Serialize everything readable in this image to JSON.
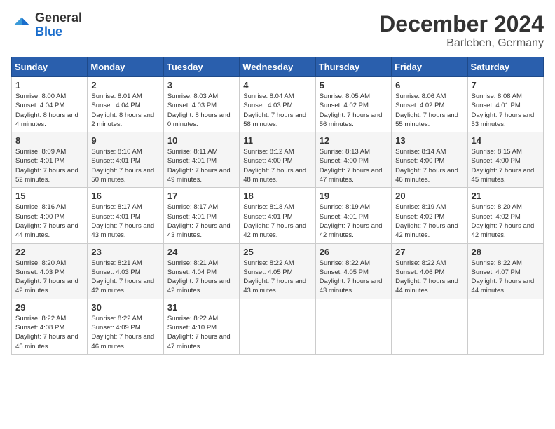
{
  "header": {
    "logo_general": "General",
    "logo_blue": "Blue",
    "month_title": "December 2024",
    "location": "Barleben, Germany"
  },
  "days_of_week": [
    "Sunday",
    "Monday",
    "Tuesday",
    "Wednesday",
    "Thursday",
    "Friday",
    "Saturday"
  ],
  "weeks": [
    [
      {
        "day": "1",
        "sunrise": "8:00 AM",
        "sunset": "4:04 PM",
        "daylight": "8 hours and 4 minutes."
      },
      {
        "day": "2",
        "sunrise": "8:01 AM",
        "sunset": "4:04 PM",
        "daylight": "8 hours and 2 minutes."
      },
      {
        "day": "3",
        "sunrise": "8:03 AM",
        "sunset": "4:03 PM",
        "daylight": "8 hours and 0 minutes."
      },
      {
        "day": "4",
        "sunrise": "8:04 AM",
        "sunset": "4:03 PM",
        "daylight": "7 hours and 58 minutes."
      },
      {
        "day": "5",
        "sunrise": "8:05 AM",
        "sunset": "4:02 PM",
        "daylight": "7 hours and 56 minutes."
      },
      {
        "day": "6",
        "sunrise": "8:06 AM",
        "sunset": "4:02 PM",
        "daylight": "7 hours and 55 minutes."
      },
      {
        "day": "7",
        "sunrise": "8:08 AM",
        "sunset": "4:01 PM",
        "daylight": "7 hours and 53 minutes."
      }
    ],
    [
      {
        "day": "8",
        "sunrise": "8:09 AM",
        "sunset": "4:01 PM",
        "daylight": "7 hours and 52 minutes."
      },
      {
        "day": "9",
        "sunrise": "8:10 AM",
        "sunset": "4:01 PM",
        "daylight": "7 hours and 50 minutes."
      },
      {
        "day": "10",
        "sunrise": "8:11 AM",
        "sunset": "4:01 PM",
        "daylight": "7 hours and 49 minutes."
      },
      {
        "day": "11",
        "sunrise": "8:12 AM",
        "sunset": "4:00 PM",
        "daylight": "7 hours and 48 minutes."
      },
      {
        "day": "12",
        "sunrise": "8:13 AM",
        "sunset": "4:00 PM",
        "daylight": "7 hours and 47 minutes."
      },
      {
        "day": "13",
        "sunrise": "8:14 AM",
        "sunset": "4:00 PM",
        "daylight": "7 hours and 46 minutes."
      },
      {
        "day": "14",
        "sunrise": "8:15 AM",
        "sunset": "4:00 PM",
        "daylight": "7 hours and 45 minutes."
      }
    ],
    [
      {
        "day": "15",
        "sunrise": "8:16 AM",
        "sunset": "4:00 PM",
        "daylight": "7 hours and 44 minutes."
      },
      {
        "day": "16",
        "sunrise": "8:17 AM",
        "sunset": "4:01 PM",
        "daylight": "7 hours and 43 minutes."
      },
      {
        "day": "17",
        "sunrise": "8:17 AM",
        "sunset": "4:01 PM",
        "daylight": "7 hours and 43 minutes."
      },
      {
        "day": "18",
        "sunrise": "8:18 AM",
        "sunset": "4:01 PM",
        "daylight": "7 hours and 42 minutes."
      },
      {
        "day": "19",
        "sunrise": "8:19 AM",
        "sunset": "4:01 PM",
        "daylight": "7 hours and 42 minutes."
      },
      {
        "day": "20",
        "sunrise": "8:19 AM",
        "sunset": "4:02 PM",
        "daylight": "7 hours and 42 minutes."
      },
      {
        "day": "21",
        "sunrise": "8:20 AM",
        "sunset": "4:02 PM",
        "daylight": "7 hours and 42 minutes."
      }
    ],
    [
      {
        "day": "22",
        "sunrise": "8:20 AM",
        "sunset": "4:03 PM",
        "daylight": "7 hours and 42 minutes."
      },
      {
        "day": "23",
        "sunrise": "8:21 AM",
        "sunset": "4:03 PM",
        "daylight": "7 hours and 42 minutes."
      },
      {
        "day": "24",
        "sunrise": "8:21 AM",
        "sunset": "4:04 PM",
        "daylight": "7 hours and 42 minutes."
      },
      {
        "day": "25",
        "sunrise": "8:22 AM",
        "sunset": "4:05 PM",
        "daylight": "7 hours and 43 minutes."
      },
      {
        "day": "26",
        "sunrise": "8:22 AM",
        "sunset": "4:05 PM",
        "daylight": "7 hours and 43 minutes."
      },
      {
        "day": "27",
        "sunrise": "8:22 AM",
        "sunset": "4:06 PM",
        "daylight": "7 hours and 44 minutes."
      },
      {
        "day": "28",
        "sunrise": "8:22 AM",
        "sunset": "4:07 PM",
        "daylight": "7 hours and 44 minutes."
      }
    ],
    [
      {
        "day": "29",
        "sunrise": "8:22 AM",
        "sunset": "4:08 PM",
        "daylight": "7 hours and 45 minutes."
      },
      {
        "day": "30",
        "sunrise": "8:22 AM",
        "sunset": "4:09 PM",
        "daylight": "7 hours and 46 minutes."
      },
      {
        "day": "31",
        "sunrise": "8:22 AM",
        "sunset": "4:10 PM",
        "daylight": "7 hours and 47 minutes."
      },
      null,
      null,
      null,
      null
    ]
  ]
}
